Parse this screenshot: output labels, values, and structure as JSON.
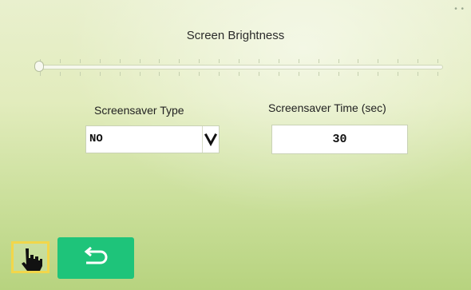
{
  "brightness": {
    "title": "Screen Brightness",
    "level_percent": 0
  },
  "screensaver_type": {
    "label": "Screensaver Type",
    "value": "NO"
  },
  "screensaver_time": {
    "label": "Screensaver Time (sec)",
    "value": "30"
  },
  "icons": {
    "hand": "hand-pointer-icon",
    "back": "return-arrow-icon",
    "dropdown": "chevron-down-icon"
  },
  "colors": {
    "back_button": "#1ec47a",
    "hand_highlight": "#f2d64a"
  }
}
